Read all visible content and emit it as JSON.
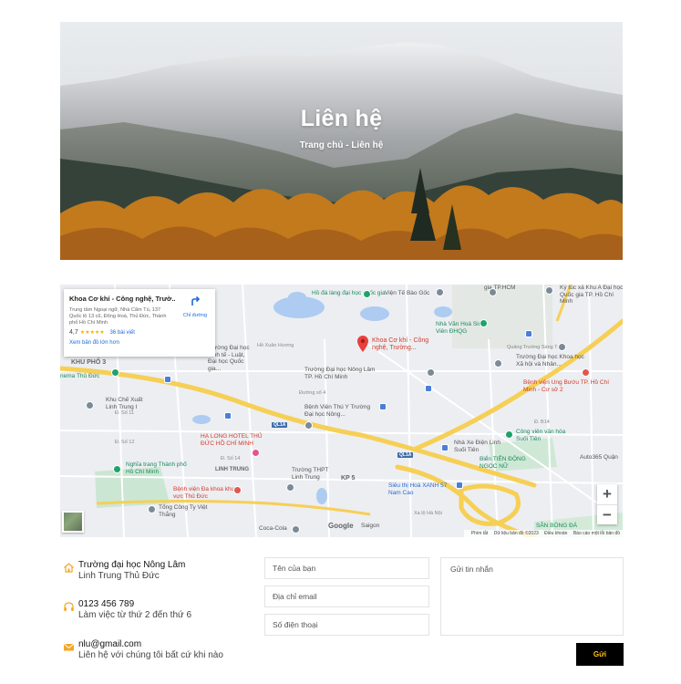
{
  "hero": {
    "title": "Liên hệ",
    "breadcrumb": "Trang chủ - Liên hệ"
  },
  "map": {
    "place_card": {
      "title": "Khoa Cơ khí - Công nghệ, Trườ...",
      "address": "Trung tâm Ngoại ngữ, Nhà Cẩm Tú, 137 Quốc lộ 13 cũ, Đông Hoà, Thủ Đức, Thành phố Hồ Chí Minh",
      "rating": "4,7",
      "stars": "★★★★★",
      "reviews": "36 bài viết",
      "larger_map": "Xem bản đồ lớn hơn",
      "directions": "Chỉ đường"
    },
    "marker_label": "Khoa Cơ khí - Công nghệ, Trường...",
    "labels": {
      "ho_da": "Hồ đá làng đại học quốc gia",
      "vien_bao_goc": "Viện Tế Bào Gốc",
      "trung_tam_hcm": "gia TP.HCM",
      "ky_tuc_xa": "Ký túc xá Khu A Đại học Quốc gia TP. Hồ Chí Minh",
      "nha_van_hoa": "Nhà Văn Hoá Sinh Viên ĐHQG",
      "kinh_te_luat": "Trường Đại học Kinh tế - Luật, Đại học Quốc gia...",
      "khu_pho_3": "KHU PHỐ 3",
      "nema_thu_duc": "nema Thủ Đức",
      "dh_nong_lam": "Trường Đại học Nông Lâm TP. Hồ Chí Minh",
      "dh_khxh": "Trường Đại học Khoa học Xã hội và Nhân...",
      "benh_vien_ung_buou": "Bệnh viện Ung Bướu TP. Hồ Chí Minh - Cơ sở 2",
      "chexuat": "Khu Chế Xuất Linh Trung I",
      "benh_vien_thu_y": "Bệnh Viện Thú Y Trường Đại học Nông...",
      "ha_long_hotel": "HẠ LONG HOTEL THỦ ĐỨC HỒ CHÍ MINH",
      "linh_trung": "LINH TRUNG",
      "nha_xe_dien": "Nhà Xe Điện Linh Suối Tiên",
      "cong_vien": "Công viên văn hóa Suối Tiên",
      "bien_tien_dong": "Biển TIÊN ĐỘNG NGỌC NỮ",
      "nghia_trang": "Nghĩa trang Thành phố Hồ Chí Minh",
      "benh_vien_da_khoa": "Bệnh viện Đa khoa khu vực Thủ Đức",
      "thpt_linh_trung": "Trường THPT Linh Trung",
      "kp5": "KP 5",
      "sieu_thi": "Siêu thị Hoà XANH 57 Nam Cao",
      "tong_cong_ty": "Tổng Công Ty Việt Thắng",
      "coca_cola": "Coca-Cola",
      "san_bong": "SÂN BÓNG ĐÁ",
      "auto365": "Auto365 Quận",
      "saigon": "Saigon",
      "quang_truong": "Quảng Trường Sáng Tạo",
      "quoc_lo_1a": "QL1A",
      "duong_so_4": "Đường số 4",
      "duong_so_11": "Đ. Số 11",
      "d_so_12": "Đ. Số 12",
      "d_so_14": "Đ. Số 14",
      "ha_noi": "Xa lộ Hà Nội",
      "duong_b14": "Đ. B14",
      "vo_van_ngan": "Hồ Xuân Hương"
    },
    "google": "Google",
    "attribution": [
      "Phím tắt",
      "Dữ liệu bản đồ ©2023",
      "Điều khoản",
      "Báo cáo một lỗi bản đồ"
    ],
    "zoom_in": "+",
    "zoom_out": "−"
  },
  "contact": {
    "address_main": "Trường đại học Nông Lâm",
    "address_sub": "Linh Trung Thủ Đức",
    "phone_main": "0123 456 789",
    "phone_sub": "Làm việc từ thứ 2 đến thứ 6",
    "email_main": "nlu@gmail.com",
    "email_sub": "Liên hệ với chúng tôi bất cứ khi nào"
  },
  "form": {
    "name_placeholder": "Tên của bạn",
    "email_placeholder": "Địa chỉ email",
    "phone_placeholder": "Số điện thoại",
    "message_placeholder": "Gửi tin nhắn",
    "send_label": "Gửi"
  },
  "colors": {
    "accent": "#f5a623",
    "button_bg": "#000000",
    "button_text": "#ffc107"
  },
  "icons": {
    "address": "home-icon",
    "phone": "headphones-icon",
    "email": "envelope-icon"
  }
}
